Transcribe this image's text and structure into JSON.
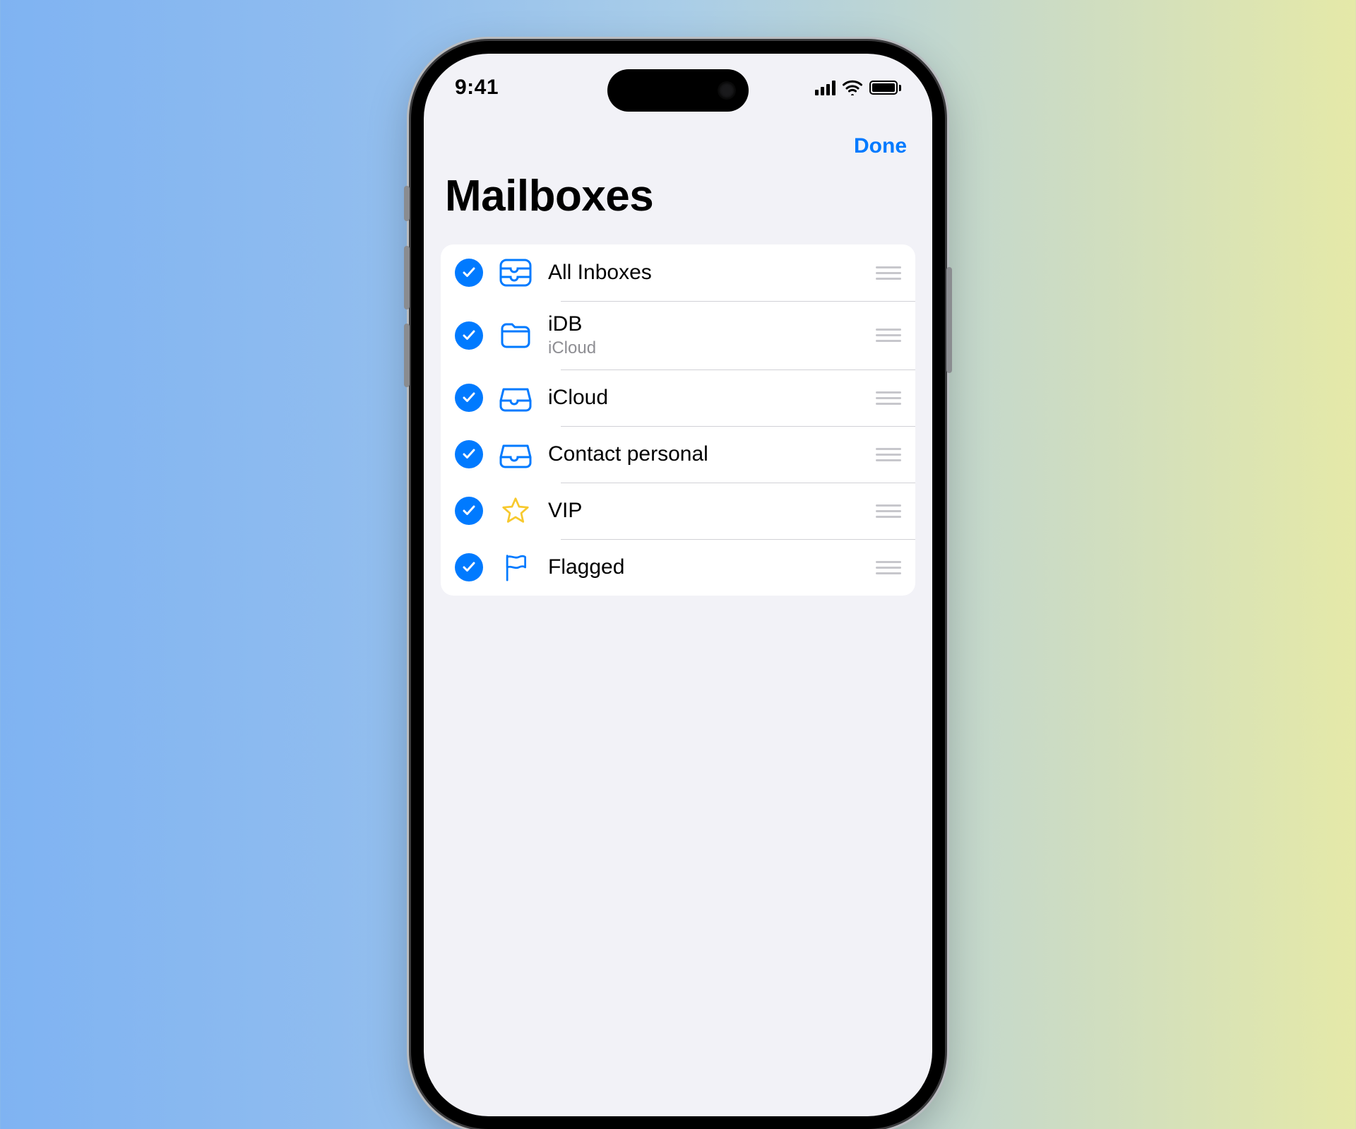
{
  "status": {
    "time": "9:41"
  },
  "nav": {
    "done_label": "Done"
  },
  "title": "Mailboxes",
  "colors": {
    "accent": "#007aff",
    "star": "#f7c92d"
  },
  "mailboxes": [
    {
      "label": "All Inboxes",
      "sublabel": null,
      "checked": true,
      "icon": "all-inboxes"
    },
    {
      "label": "iDB",
      "sublabel": "iCloud",
      "checked": true,
      "icon": "folder"
    },
    {
      "label": "iCloud",
      "sublabel": null,
      "checked": true,
      "icon": "inbox"
    },
    {
      "label": "Contact personal",
      "sublabel": null,
      "checked": true,
      "icon": "inbox"
    },
    {
      "label": "VIP",
      "sublabel": null,
      "checked": true,
      "icon": "star"
    },
    {
      "label": "Flagged",
      "sublabel": null,
      "checked": true,
      "icon": "flag"
    }
  ]
}
